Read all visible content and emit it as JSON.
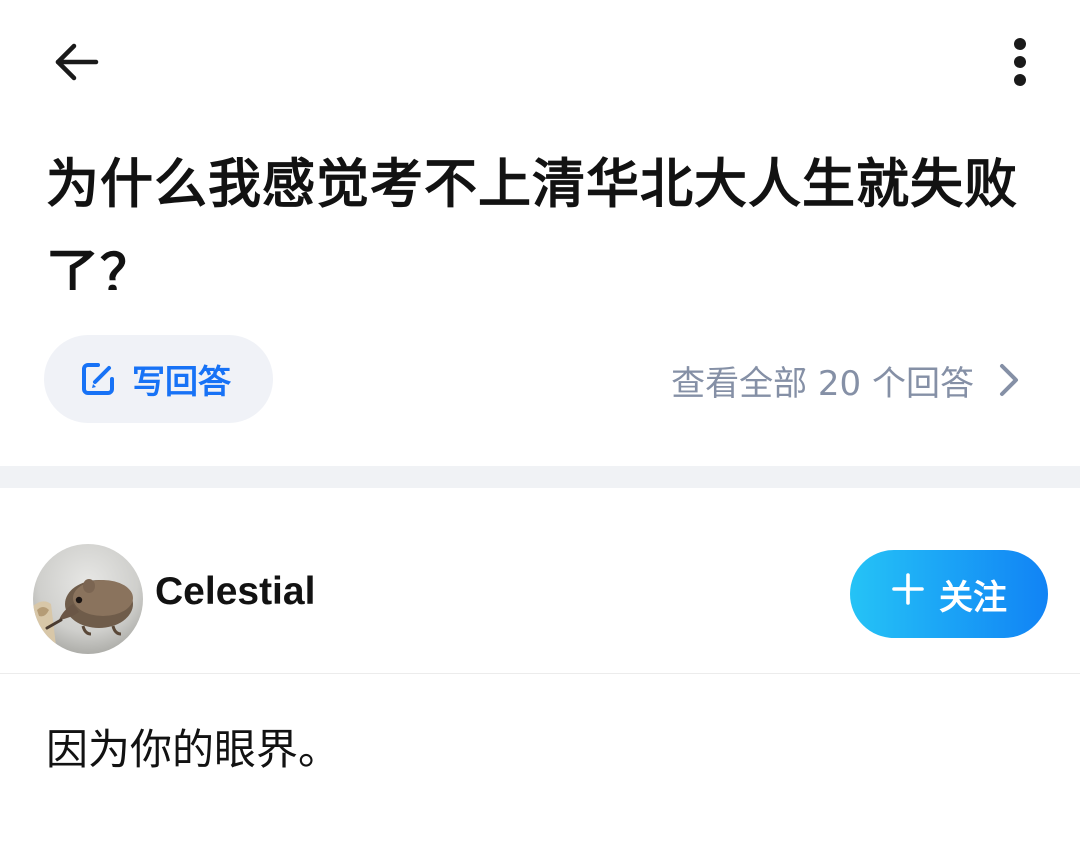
{
  "header": {
    "back_icon": "arrow-left-icon",
    "more_icon": "more-vertical-icon"
  },
  "question": {
    "title": "为什么我感觉考不上清华北大人生就失败了？"
  },
  "actions": {
    "write_answer_label": "写回答",
    "write_answer_icon": "edit-icon",
    "view_all_label": "查看全部 20 个回答",
    "view_all_icon": "chevron-right-icon"
  },
  "author": {
    "name": "Celestial",
    "avatar_icon": "avatar-shrew-photo",
    "follow_label": "关注",
    "follow_icon": "plus-icon"
  },
  "answer": {
    "body": "因为你的眼界。"
  },
  "colors": {
    "accent": "#1772f6",
    "follow_gradient_start": "#25c3f6",
    "follow_gradient_end": "#1183f5",
    "secondary_text": "#8590a6",
    "pill_bg": "#f0f2f7",
    "divider": "#f0f2f5"
  }
}
